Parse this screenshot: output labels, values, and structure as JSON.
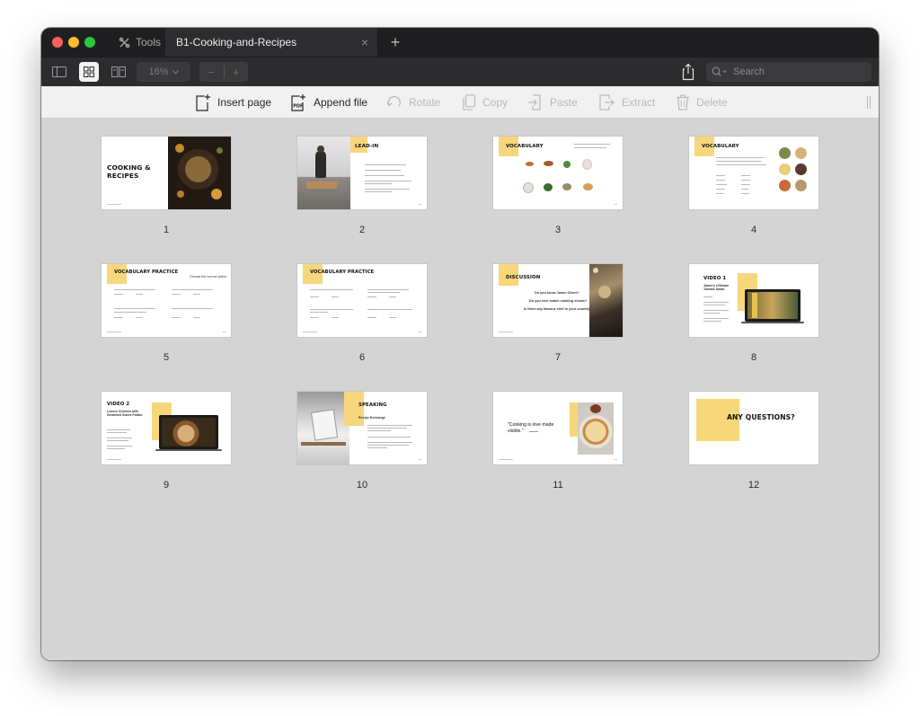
{
  "titlebar": {
    "tools_label": "Tools",
    "document_tab": "B1-Cooking-and-Recipes",
    "close_glyph": "×",
    "new_tab_glyph": "+"
  },
  "toolbar": {
    "zoom_value": "16%",
    "zoom_out_glyph": "−",
    "zoom_in_glyph": "+",
    "search_placeholder": "Search",
    "icons": [
      "sidebar-icon",
      "grid-view-icon",
      "two-page-icon",
      "share-icon",
      "search-icon"
    ]
  },
  "actions": {
    "insert_page": "Insert page",
    "append_file": "Append file",
    "rotate": "Rotate",
    "copy": "Copy",
    "paste": "Paste",
    "extract": "Extract",
    "delete": "Delete",
    "append_badge": "PDF"
  },
  "pages": [
    {
      "number": "1",
      "title": "COOKING & RECIPES"
    },
    {
      "number": "2",
      "title": "LEAD-IN"
    },
    {
      "number": "3",
      "title": "VOCABULARY"
    },
    {
      "number": "4",
      "title": "VOCABULARY"
    },
    {
      "number": "5",
      "title": "VOCABULARY PRACTICE"
    },
    {
      "number": "6",
      "title": "VOCABULARY PRACTICE"
    },
    {
      "number": "7",
      "title": "DISCUSSION"
    },
    {
      "number": "8",
      "title": "VIDEO 1"
    },
    {
      "number": "9",
      "title": "VIDEO 2"
    },
    {
      "number": "10",
      "title": "SPEAKING"
    },
    {
      "number": "11",
      "title": "\"Cooking is love made visible.\""
    },
    {
      "number": "12",
      "title": "ANY QUESTIONS?"
    }
  ],
  "slide_text": {
    "p1_line1": "COOKING &",
    "p1_line2": "RECIPES",
    "p5_sub": "Choose the correct option",
    "p7_q1": "Do you know Jamie Oliver?",
    "p7_q2": "Do you ever watch cooking shows?",
    "p7_q3": "Is there any famous chef in your country?",
    "p8_sub": "Jamie's Ultimate Tomato Salad",
    "p9_sub": "Lemon Chicken with Smashed Sweet Potato",
    "p10_sub": "Recipe Exchange",
    "p10_title": "SPEAKING",
    "p11_quote_l1": "\"Cooking is love made",
    "p11_quote_l2": "visible.\""
  },
  "colors": {
    "accent_yellow": "#f7d77c",
    "canvas": "#d4d4d4",
    "titlebar": "#1f1f21",
    "toolbar": "#2c2c2e",
    "actionbar": "#f1f1f1"
  }
}
